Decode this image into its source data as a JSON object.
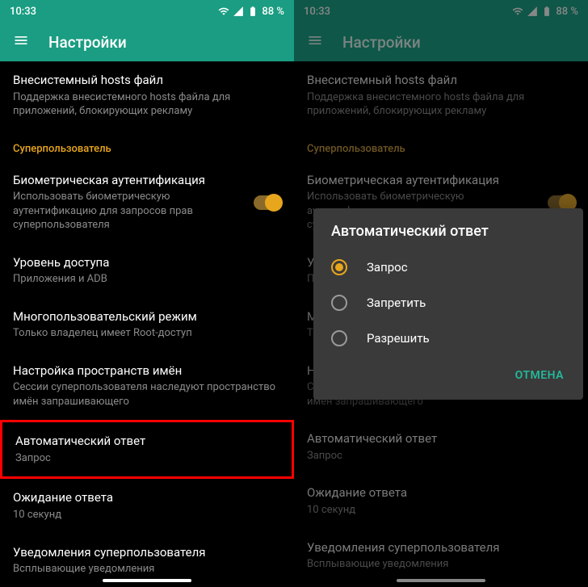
{
  "status": {
    "time": "10:33",
    "battery": "88 %"
  },
  "header": {
    "title": "Настройки"
  },
  "settings": {
    "hosts": {
      "title": "Внесистемный hosts файл",
      "sub": "Поддержка внесистемного hosts файла для приложений, блокирующих рекламу"
    },
    "su_section": "Суперпользователь",
    "biometric": {
      "title": "Биометрическая аутентификация",
      "sub": "Использовать биометрическую аутентификацию для запросов прав суперпользователя"
    },
    "access": {
      "title": "Уровень доступа",
      "sub": "Приложения и ADB"
    },
    "access_dim": {
      "title": "У",
      "sub": "П"
    },
    "multiuser": {
      "title": "Многопользовательский режим",
      "sub": "Только владелец имеет Root-доступ"
    },
    "multiuser_dim": {
      "title": "М",
      "sub": "Т"
    },
    "namespace": {
      "title": "Настройка пространств имён",
      "sub": "Сессии суперпользователя наследуют пространство имён запрашивающего"
    },
    "namespace_dim": {
      "title": "Н",
      "sub1": "С",
      "sub2": "имён запрашивающего"
    },
    "auto_response": {
      "title": "Автоматический ответ",
      "sub": "Запрос"
    },
    "timeout": {
      "title": "Ожидание ответа",
      "sub": "10 секунд"
    },
    "notifications": {
      "title": "Уведомления суперпользователя",
      "sub": "Всплывающие уведомления"
    }
  },
  "dialog": {
    "title": "Автоматический ответ",
    "options": {
      "prompt": "Запрос",
      "deny": "Запретить",
      "allow": "Разрешить"
    },
    "cancel": "ОТМЕНА"
  }
}
